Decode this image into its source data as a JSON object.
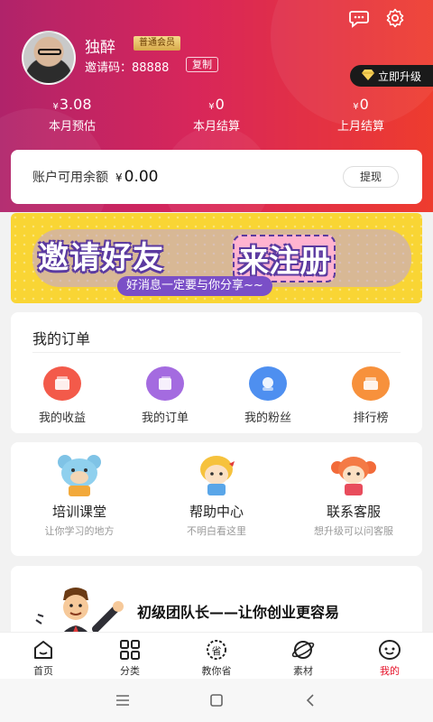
{
  "profile": {
    "username": "独醉",
    "member_level": "普通会员",
    "invite_label": "邀请码：",
    "invite_code": "88888",
    "copy_label": "复制",
    "upgrade_label": "立即升级"
  },
  "stats": [
    {
      "currency": "¥",
      "value": "3.08",
      "label": "本月预估"
    },
    {
      "currency": "¥",
      "value": "0",
      "label": "本月结算"
    },
    {
      "currency": "¥",
      "value": "0",
      "label": "上月结算"
    }
  ],
  "balance": {
    "label": "账户可用余额",
    "currency": "¥",
    "amount": "0.00",
    "withdraw_label": "提现"
  },
  "banner": {
    "title": "邀请好友",
    "highlight": "来注册",
    "subtitle": "好消息一定要与你分享~~"
  },
  "orders": {
    "heading": "我的订单",
    "items": [
      {
        "label": "我的收益",
        "icon": "earnings-icon",
        "color": "#f35a4a"
      },
      {
        "label": "我的订单",
        "icon": "orders-icon",
        "color": "#a46be0"
      },
      {
        "label": "我的粉丝",
        "icon": "fans-icon",
        "color": "#4e8ff0"
      },
      {
        "label": "排行榜",
        "icon": "ranking-icon",
        "color": "#f7913c"
      }
    ]
  },
  "help": {
    "items": [
      {
        "title": "培训课堂",
        "subtitle": "让你学习的地方"
      },
      {
        "title": "帮助中心",
        "subtitle": "不明白看这里"
      },
      {
        "title": "联系客服",
        "subtitle": "想升级可以问客服"
      }
    ]
  },
  "promo": {
    "text": "初级团队长——让你创业更容易"
  },
  "tabbar": {
    "items": [
      {
        "label": "首页",
        "icon": "home-icon"
      },
      {
        "label": "分类",
        "icon": "category-icon"
      },
      {
        "label": "教你省",
        "icon": "save-icon"
      },
      {
        "label": "素材",
        "icon": "material-icon"
      },
      {
        "label": "我的",
        "icon": "profile-icon",
        "active": true
      }
    ]
  },
  "colors": {
    "accent": "#e6132a",
    "header_start": "#b0236a",
    "header_end": "#ee3c2e",
    "banner_bg": "#f9d534"
  }
}
